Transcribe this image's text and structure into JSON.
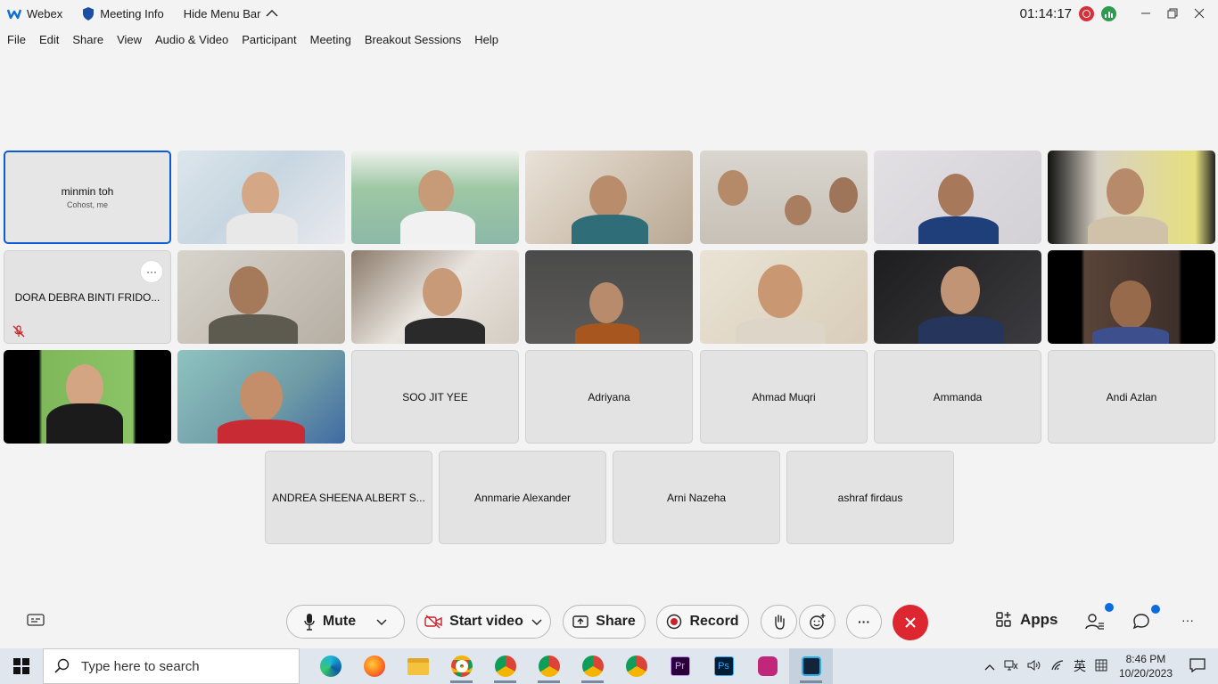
{
  "titlebar": {
    "app_name": "Webex",
    "meeting_info": "Meeting Info",
    "hide_menu": "Hide Menu Bar",
    "timer": "01:14:17"
  },
  "menu": [
    "File",
    "Edit",
    "Share",
    "View",
    "Audio & Video",
    "Participant",
    "Meeting",
    "Breakout Sessions",
    "Help"
  ],
  "self_tile": {
    "name": "minmin toh",
    "role": "Cohost, me"
  },
  "name_tiles": {
    "dora": "DORA DEBRA BINTI FRIDO...",
    "soo": "SOO JIT YEE",
    "adriyana": "Adriyana",
    "ahmad": "Ahmad Muqri",
    "ammanda": "Ammanda",
    "andi": "Andi Azlan",
    "andrea": "ANDREA SHEENA ALBERT S...",
    "annmarie": "Annmarie Alexander",
    "arni": "Arni Nazeha",
    "ashraf": "ashraf firdaus"
  },
  "more_label": "···",
  "controls": {
    "mute": "Mute",
    "start_video": "Start video",
    "share": "Share",
    "record": "Record",
    "apps": "Apps",
    "more": "···"
  },
  "taskbar": {
    "search_placeholder": "Type here to search",
    "time": "8:46 PM",
    "date": "10/20/2023",
    "ime": "英"
  },
  "colors": {
    "accent": "#0b5bd7",
    "end_call": "#dc2630",
    "recording": "#d6303b",
    "network": "#2f9b4e"
  }
}
